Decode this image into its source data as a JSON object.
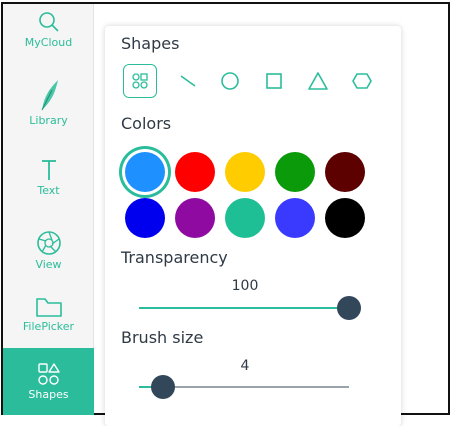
{
  "sidebar": {
    "items": [
      {
        "label": "MyCloud",
        "icon": "search-icon",
        "active": false
      },
      {
        "label": "Library",
        "icon": "feather-icon",
        "active": false
      },
      {
        "label": "Text",
        "icon": "text-icon",
        "active": false
      },
      {
        "label": "View",
        "icon": "aperture-icon",
        "active": false
      },
      {
        "label": "FilePicker",
        "icon": "folder-icon",
        "active": false
      },
      {
        "label": "Shapes",
        "icon": "shapes-icon",
        "active": true
      }
    ]
  },
  "panel": {
    "shapes_label": "Shapes",
    "shapes": [
      "mixed-shapes-icon",
      "line-icon",
      "circle-icon",
      "square-icon",
      "triangle-icon",
      "hexagon-icon"
    ],
    "selected_shape": "mixed-shapes-icon",
    "colors_label": "Colors",
    "colors": [
      "#1e90ff",
      "#ff0000",
      "#ffcc00",
      "#0a9a0a",
      "#5c0000",
      "#0000ee",
      "#8e0aa0",
      "#1fbf95",
      "#3a3aff",
      "#000000"
    ],
    "selected_color": "#1e90ff",
    "transparency_label": "Transparency",
    "transparency_value": "100",
    "brush_label": "Brush size",
    "brush_value": "4"
  },
  "theme": {
    "accent": "#2bbd9b",
    "thumb": "#33475b"
  }
}
